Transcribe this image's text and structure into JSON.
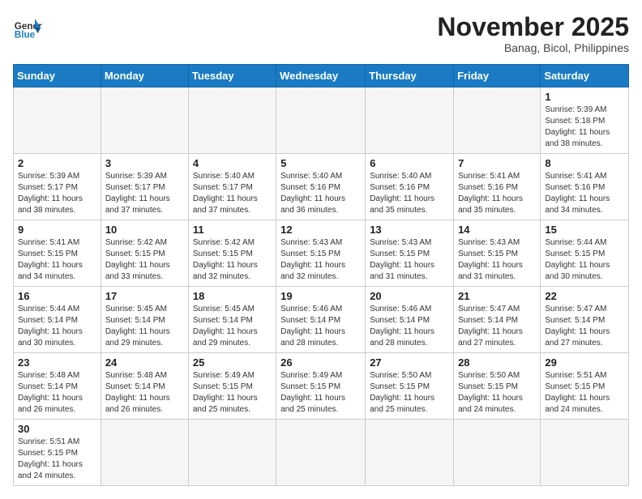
{
  "header": {
    "logo_general": "General",
    "logo_blue": "Blue",
    "month_title": "November 2025",
    "location": "Banag, Bicol, Philippines"
  },
  "weekdays": [
    "Sunday",
    "Monday",
    "Tuesday",
    "Wednesday",
    "Thursday",
    "Friday",
    "Saturday"
  ],
  "days": [
    {
      "number": "",
      "info": ""
    },
    {
      "number": "",
      "info": ""
    },
    {
      "number": "",
      "info": ""
    },
    {
      "number": "",
      "info": ""
    },
    {
      "number": "",
      "info": ""
    },
    {
      "number": "",
      "info": ""
    },
    {
      "number": "1",
      "sunrise": "Sunrise: 5:39 AM",
      "sunset": "Sunset: 5:18 PM",
      "daylight": "Daylight: 11 hours and 38 minutes."
    },
    {
      "number": "2",
      "sunrise": "Sunrise: 5:39 AM",
      "sunset": "Sunset: 5:17 PM",
      "daylight": "Daylight: 11 hours and 38 minutes."
    },
    {
      "number": "3",
      "sunrise": "Sunrise: 5:39 AM",
      "sunset": "Sunset: 5:17 PM",
      "daylight": "Daylight: 11 hours and 37 minutes."
    },
    {
      "number": "4",
      "sunrise": "Sunrise: 5:40 AM",
      "sunset": "Sunset: 5:17 PM",
      "daylight": "Daylight: 11 hours and 37 minutes."
    },
    {
      "number": "5",
      "sunrise": "Sunrise: 5:40 AM",
      "sunset": "Sunset: 5:16 PM",
      "daylight": "Daylight: 11 hours and 36 minutes."
    },
    {
      "number": "6",
      "sunrise": "Sunrise: 5:40 AM",
      "sunset": "Sunset: 5:16 PM",
      "daylight": "Daylight: 11 hours and 35 minutes."
    },
    {
      "number": "7",
      "sunrise": "Sunrise: 5:41 AM",
      "sunset": "Sunset: 5:16 PM",
      "daylight": "Daylight: 11 hours and 35 minutes."
    },
    {
      "number": "8",
      "sunrise": "Sunrise: 5:41 AM",
      "sunset": "Sunset: 5:16 PM",
      "daylight": "Daylight: 11 hours and 34 minutes."
    },
    {
      "number": "9",
      "sunrise": "Sunrise: 5:41 AM",
      "sunset": "Sunset: 5:15 PM",
      "daylight": "Daylight: 11 hours and 34 minutes."
    },
    {
      "number": "10",
      "sunrise": "Sunrise: 5:42 AM",
      "sunset": "Sunset: 5:15 PM",
      "daylight": "Daylight: 11 hours and 33 minutes."
    },
    {
      "number": "11",
      "sunrise": "Sunrise: 5:42 AM",
      "sunset": "Sunset: 5:15 PM",
      "daylight": "Daylight: 11 hours and 32 minutes."
    },
    {
      "number": "12",
      "sunrise": "Sunrise: 5:43 AM",
      "sunset": "Sunset: 5:15 PM",
      "daylight": "Daylight: 11 hours and 32 minutes."
    },
    {
      "number": "13",
      "sunrise": "Sunrise: 5:43 AM",
      "sunset": "Sunset: 5:15 PM",
      "daylight": "Daylight: 11 hours and 31 minutes."
    },
    {
      "number": "14",
      "sunrise": "Sunrise: 5:43 AM",
      "sunset": "Sunset: 5:15 PM",
      "daylight": "Daylight: 11 hours and 31 minutes."
    },
    {
      "number": "15",
      "sunrise": "Sunrise: 5:44 AM",
      "sunset": "Sunset: 5:15 PM",
      "daylight": "Daylight: 11 hours and 30 minutes."
    },
    {
      "number": "16",
      "sunrise": "Sunrise: 5:44 AM",
      "sunset": "Sunset: 5:14 PM",
      "daylight": "Daylight: 11 hours and 30 minutes."
    },
    {
      "number": "17",
      "sunrise": "Sunrise: 5:45 AM",
      "sunset": "Sunset: 5:14 PM",
      "daylight": "Daylight: 11 hours and 29 minutes."
    },
    {
      "number": "18",
      "sunrise": "Sunrise: 5:45 AM",
      "sunset": "Sunset: 5:14 PM",
      "daylight": "Daylight: 11 hours and 29 minutes."
    },
    {
      "number": "19",
      "sunrise": "Sunrise: 5:46 AM",
      "sunset": "Sunset: 5:14 PM",
      "daylight": "Daylight: 11 hours and 28 minutes."
    },
    {
      "number": "20",
      "sunrise": "Sunrise: 5:46 AM",
      "sunset": "Sunset: 5:14 PM",
      "daylight": "Daylight: 11 hours and 28 minutes."
    },
    {
      "number": "21",
      "sunrise": "Sunrise: 5:47 AM",
      "sunset": "Sunset: 5:14 PM",
      "daylight": "Daylight: 11 hours and 27 minutes."
    },
    {
      "number": "22",
      "sunrise": "Sunrise: 5:47 AM",
      "sunset": "Sunset: 5:14 PM",
      "daylight": "Daylight: 11 hours and 27 minutes."
    },
    {
      "number": "23",
      "sunrise": "Sunrise: 5:48 AM",
      "sunset": "Sunset: 5:14 PM",
      "daylight": "Daylight: 11 hours and 26 minutes."
    },
    {
      "number": "24",
      "sunrise": "Sunrise: 5:48 AM",
      "sunset": "Sunset: 5:14 PM",
      "daylight": "Daylight: 11 hours and 26 minutes."
    },
    {
      "number": "25",
      "sunrise": "Sunrise: 5:49 AM",
      "sunset": "Sunset: 5:15 PM",
      "daylight": "Daylight: 11 hours and 25 minutes."
    },
    {
      "number": "26",
      "sunrise": "Sunrise: 5:49 AM",
      "sunset": "Sunset: 5:15 PM",
      "daylight": "Daylight: 11 hours and 25 minutes."
    },
    {
      "number": "27",
      "sunrise": "Sunrise: 5:50 AM",
      "sunset": "Sunset: 5:15 PM",
      "daylight": "Daylight: 11 hours and 25 minutes."
    },
    {
      "number": "28",
      "sunrise": "Sunrise: 5:50 AM",
      "sunset": "Sunset: 5:15 PM",
      "daylight": "Daylight: 11 hours and 24 minutes."
    },
    {
      "number": "29",
      "sunrise": "Sunrise: 5:51 AM",
      "sunset": "Sunset: 5:15 PM",
      "daylight": "Daylight: 11 hours and 24 minutes."
    },
    {
      "number": "30",
      "sunrise": "Sunrise: 5:51 AM",
      "sunset": "Sunset: 5:15 PM",
      "daylight": "Daylight: 11 hours and 24 minutes."
    }
  ]
}
